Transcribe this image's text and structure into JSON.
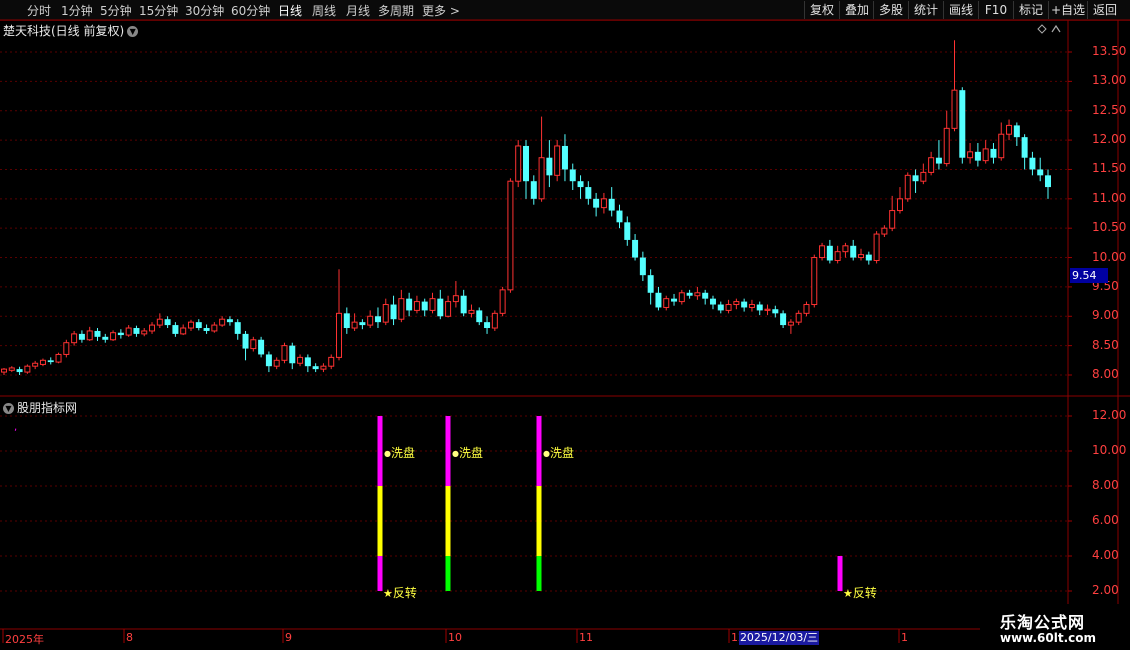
{
  "toolbar": {
    "tabs": [
      "分时",
      "1分钟",
      "5分钟",
      "15分钟",
      "30分钟",
      "60分钟",
      "日线",
      "周线",
      "月线",
      "多周期",
      "更多 >"
    ],
    "active_tab": "日线",
    "buttons": [
      "复权",
      "叠加",
      "多股",
      "统计",
      "画线",
      "F10",
      "标记",
      "+自选",
      "返回"
    ]
  },
  "main": {
    "title": "楚天科技(日线 前复权)",
    "price_axis": [
      "13.50",
      "13.00",
      "12.50",
      "12.00",
      "11.50",
      "11.00",
      "10.50",
      "10.00",
      "9.50",
      "9.00",
      "8.50",
      "8.00"
    ],
    "current_price": "9.54"
  },
  "indicator": {
    "title": "股朋指标网",
    "axis": [
      "12.00",
      "10.00",
      "8.00",
      "6.00",
      "4.00",
      "2.00"
    ],
    "signals": [
      {
        "label": "洗盘"
      },
      {
        "label": "洗盘"
      },
      {
        "label": "洗盘"
      },
      {
        "label": "反转"
      },
      {
        "label": "反转"
      }
    ]
  },
  "time_axis": {
    "labels": [
      "2025年",
      "8",
      "9",
      "10",
      "11",
      "12",
      "1"
    ],
    "cursor_date": "2025/12/03/三"
  },
  "colors": {
    "up": "#ff3232",
    "down": "#54ffff",
    "magenta": "#ff00ff",
    "yellow": "#ffff00",
    "green": "#00ff00"
  },
  "watermark": {
    "line1": "乐淘公式网",
    "line2": "www.60lt.com"
  },
  "chart_data": {
    "type": "candlestick",
    "ylim": [
      7.8,
      13.8
    ],
    "candles": [
      [
        8.05,
        8.1,
        8.0,
        8.12
      ],
      [
        8.08,
        8.12,
        8.05,
        8.15
      ],
      [
        8.1,
        8.05,
        8.0,
        8.14
      ],
      [
        8.05,
        8.15,
        8.02,
        8.18
      ],
      [
        8.15,
        8.2,
        8.1,
        8.24
      ],
      [
        8.18,
        8.25,
        8.15,
        8.28
      ],
      [
        8.25,
        8.22,
        8.18,
        8.3
      ],
      [
        8.22,
        8.35,
        8.2,
        8.38
      ],
      [
        8.35,
        8.55,
        8.3,
        8.6
      ],
      [
        8.55,
        8.7,
        8.5,
        8.75
      ],
      [
        8.7,
        8.6,
        8.55,
        8.76
      ],
      [
        8.6,
        8.75,
        8.58,
        8.82
      ],
      [
        8.75,
        8.65,
        8.58,
        8.8
      ],
      [
        8.65,
        8.6,
        8.55,
        8.7
      ],
      [
        8.6,
        8.72,
        8.58,
        8.76
      ],
      [
        8.72,
        8.68,
        8.62,
        8.78
      ],
      [
        8.68,
        8.8,
        8.65,
        8.85
      ],
      [
        8.8,
        8.7,
        8.65,
        8.84
      ],
      [
        8.7,
        8.75,
        8.66,
        8.8
      ],
      [
        8.75,
        8.85,
        8.7,
        8.9
      ],
      [
        8.85,
        8.95,
        8.8,
        9.05
      ],
      [
        8.95,
        8.85,
        8.8,
        9.0
      ],
      [
        8.85,
        8.7,
        8.65,
        8.9
      ],
      [
        8.7,
        8.8,
        8.68,
        8.86
      ],
      [
        8.8,
        8.9,
        8.75,
        8.94
      ],
      [
        8.9,
        8.8,
        8.76,
        8.95
      ],
      [
        8.8,
        8.75,
        8.7,
        8.86
      ],
      [
        8.75,
        8.85,
        8.72,
        8.9
      ],
      [
        8.85,
        8.95,
        8.82,
        9.0
      ],
      [
        8.95,
        8.9,
        8.84,
        9.0
      ],
      [
        8.9,
        8.7,
        8.6,
        8.95
      ],
      [
        8.7,
        8.45,
        8.25,
        8.75
      ],
      [
        8.45,
        8.6,
        8.4,
        8.65
      ],
      [
        8.6,
        8.35,
        8.3,
        8.65
      ],
      [
        8.35,
        8.15,
        8.05,
        8.4
      ],
      [
        8.15,
        8.25,
        8.1,
        8.3
      ],
      [
        8.25,
        8.5,
        8.2,
        8.55
      ],
      [
        8.5,
        8.2,
        8.1,
        8.55
      ],
      [
        8.2,
        8.3,
        8.15,
        8.35
      ],
      [
        8.3,
        8.15,
        8.05,
        8.35
      ],
      [
        8.15,
        8.1,
        8.05,
        8.2
      ],
      [
        8.1,
        8.15,
        8.05,
        8.2
      ],
      [
        8.15,
        8.3,
        8.1,
        8.35
      ],
      [
        8.3,
        9.05,
        8.25,
        9.8
      ],
      [
        9.05,
        8.8,
        8.7,
        9.15
      ],
      [
        8.8,
        8.9,
        8.75,
        9.05
      ],
      [
        8.9,
        8.85,
        8.78,
        8.95
      ],
      [
        8.85,
        9.0,
        8.8,
        9.1
      ],
      [
        9.0,
        8.9,
        8.8,
        9.15
      ],
      [
        8.9,
        9.2,
        8.85,
        9.3
      ],
      [
        9.2,
        8.95,
        8.85,
        9.35
      ],
      [
        8.95,
        9.3,
        8.9,
        9.45
      ],
      [
        9.3,
        9.1,
        9.0,
        9.4
      ],
      [
        9.1,
        9.25,
        9.05,
        9.35
      ],
      [
        9.25,
        9.1,
        9.0,
        9.3
      ],
      [
        9.1,
        9.3,
        9.05,
        9.4
      ],
      [
        9.3,
        9.0,
        8.95,
        9.45
      ],
      [
        9.0,
        9.25,
        8.98,
        9.35
      ],
      [
        9.25,
        9.35,
        9.15,
        9.6
      ],
      [
        9.35,
        9.05,
        9.0,
        9.45
      ],
      [
        9.05,
        9.1,
        8.98,
        9.2
      ],
      [
        9.1,
        8.9,
        8.85,
        9.15
      ],
      [
        8.9,
        8.8,
        8.7,
        9.0
      ],
      [
        8.8,
        9.05,
        8.75,
        9.1
      ],
      [
        9.05,
        9.45,
        9.0,
        9.5
      ],
      [
        9.45,
        11.3,
        9.4,
        11.35
      ],
      [
        11.3,
        11.9,
        11.2,
        12.0
      ],
      [
        11.9,
        11.3,
        11.0,
        12.0
      ],
      [
        11.3,
        11.0,
        10.9,
        11.4
      ],
      [
        11.0,
        11.7,
        10.95,
        12.4
      ],
      [
        11.7,
        11.4,
        11.2,
        12.0
      ],
      [
        11.4,
        11.9,
        11.3,
        12.0
      ],
      [
        11.9,
        11.5,
        11.3,
        12.1
      ],
      [
        11.5,
        11.3,
        11.15,
        11.6
      ],
      [
        11.3,
        11.2,
        11.0,
        11.4
      ],
      [
        11.2,
        11.0,
        10.9,
        11.3
      ],
      [
        11.0,
        10.85,
        10.7,
        11.1
      ],
      [
        10.85,
        11.0,
        10.75,
        11.1
      ],
      [
        11.0,
        10.8,
        10.7,
        11.2
      ],
      [
        10.8,
        10.6,
        10.5,
        10.9
      ],
      [
        10.6,
        10.3,
        10.2,
        10.7
      ],
      [
        10.3,
        10.0,
        9.95,
        10.4
      ],
      [
        10.0,
        9.7,
        9.6,
        10.1
      ],
      [
        9.7,
        9.4,
        9.2,
        9.8
      ],
      [
        9.4,
        9.15,
        9.1,
        9.5
      ],
      [
        9.15,
        9.3,
        9.1,
        9.35
      ],
      [
        9.3,
        9.25,
        9.18,
        9.38
      ],
      [
        9.25,
        9.4,
        9.2,
        9.45
      ],
      [
        9.4,
        9.35,
        9.3,
        9.45
      ],
      [
        9.35,
        9.4,
        9.28,
        9.5
      ],
      [
        9.4,
        9.3,
        9.2,
        9.45
      ],
      [
        9.3,
        9.2,
        9.12,
        9.35
      ],
      [
        9.2,
        9.1,
        9.05,
        9.25
      ],
      [
        9.1,
        9.2,
        9.05,
        9.28
      ],
      [
        9.2,
        9.25,
        9.12,
        9.3
      ],
      [
        9.25,
        9.15,
        9.08,
        9.3
      ],
      [
        9.15,
        9.2,
        9.08,
        9.28
      ],
      [
        9.2,
        9.1,
        9.02,
        9.25
      ],
      [
        9.1,
        9.12,
        9.02,
        9.2
      ],
      [
        9.12,
        9.05,
        8.98,
        9.18
      ],
      [
        9.05,
        8.85,
        8.8,
        9.1
      ],
      [
        8.85,
        8.9,
        8.7,
        8.95
      ],
      [
        8.9,
        9.05,
        8.85,
        9.1
      ],
      [
        9.05,
        9.2,
        9.0,
        9.25
      ],
      [
        9.2,
        10.0,
        9.15,
        10.05
      ],
      [
        10.0,
        10.2,
        9.95,
        10.25
      ],
      [
        10.2,
        9.95,
        9.9,
        10.3
      ],
      [
        9.95,
        10.1,
        9.9,
        10.2
      ],
      [
        10.1,
        10.2,
        10.0,
        10.25
      ],
      [
        10.2,
        10.0,
        9.95,
        10.3
      ],
      [
        10.0,
        10.05,
        9.95,
        10.15
      ],
      [
        10.05,
        9.95,
        9.88,
        10.1
      ],
      [
        9.95,
        10.4,
        9.9,
        10.45
      ],
      [
        10.4,
        10.5,
        10.35,
        10.55
      ],
      [
        10.5,
        10.8,
        10.45,
        11.05
      ],
      [
        10.8,
        11.0,
        10.75,
        11.2
      ],
      [
        11.0,
        11.4,
        10.95,
        11.45
      ],
      [
        11.4,
        11.3,
        11.1,
        11.5
      ],
      [
        11.3,
        11.45,
        11.25,
        11.6
      ],
      [
        11.45,
        11.7,
        11.4,
        11.8
      ],
      [
        11.7,
        11.6,
        11.5,
        12.0
      ],
      [
        11.6,
        12.2,
        11.55,
        12.5
      ],
      [
        12.2,
        12.85,
        12.15,
        13.7
      ],
      [
        12.85,
        11.7,
        11.6,
        12.9
      ],
      [
        11.7,
        11.8,
        11.6,
        11.95
      ],
      [
        11.8,
        11.65,
        11.55,
        11.95
      ],
      [
        11.65,
        11.85,
        11.6,
        12.0
      ],
      [
        11.85,
        11.7,
        11.6,
        11.95
      ],
      [
        11.7,
        12.1,
        11.65,
        12.3
      ],
      [
        12.1,
        12.25,
        12.0,
        12.35
      ],
      [
        12.25,
        12.05,
        11.9,
        12.3
      ],
      [
        12.05,
        11.7,
        11.5,
        12.1
      ],
      [
        11.7,
        11.5,
        11.4,
        11.8
      ],
      [
        11.5,
        11.4,
        11.3,
        11.7
      ],
      [
        11.4,
        11.2,
        11.0,
        11.5
      ]
    ],
    "indicator_bars": [
      {
        "bottom": 2,
        "top": 12,
        "colors": [
          "magenta",
          "yellow",
          "magenta"
        ]
      },
      {
        "bottom": 2,
        "top": 12,
        "colors": [
          "green",
          "yellow",
          "magenta"
        ]
      },
      {
        "bottom": 2,
        "top": 12,
        "colors": [
          "green",
          "yellow",
          "magenta"
        ]
      },
      {
        "bottom": 2,
        "top": 4,
        "colors": [
          "magenta"
        ]
      }
    ],
    "indicator_ylim": [
      1.0,
      13.0
    ]
  }
}
